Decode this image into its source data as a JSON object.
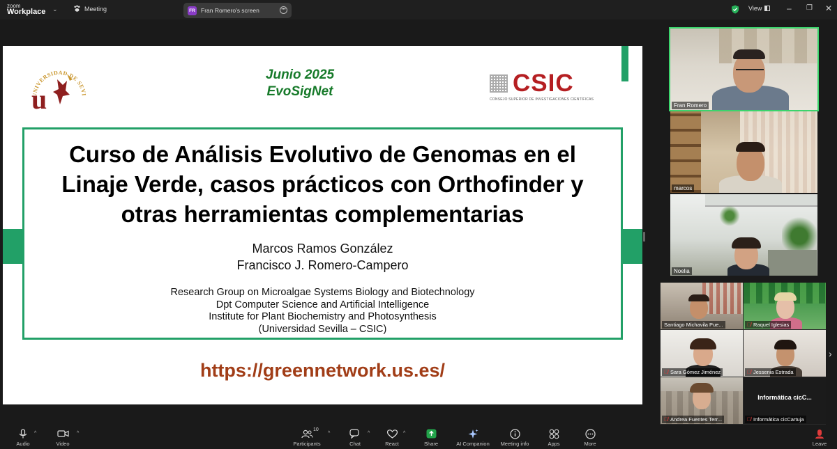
{
  "app": {
    "brand_line1": "zoom",
    "brand_line2": "Workplace"
  },
  "tabs": {
    "meeting": "Meeting",
    "share_badge": "FR",
    "share": "Fran Romero's screen"
  },
  "window": {
    "view": "View"
  },
  "slide": {
    "date_line1": "Junio 2025",
    "date_line2": "EvoSigNet",
    "university_ring": "UNIVERSIDAD DE SEVILLA",
    "csic_word": "CSIC",
    "csic_sub": "CONSEJO SUPERIOR DE INVESTIGACIONES CIENTÍFICAS",
    "title_line1": "Curso de Análisis Evolutivo de Genomas en el",
    "title_line2": "Linaje Verde, casos prácticos con Orthofinder y",
    "title_line3": "otras herramientas complementarias",
    "author1": "Marcos Ramos González",
    "author2": "Francisco J. Romero-Campero",
    "affil1": "Research Group on Microalgae Systems Biology and Biotechnology",
    "affil2": "Dpt Computer Science and Artificial Intelligence",
    "affil3": "Institute for Plant Biochemistry and Photosynthesis",
    "affil4": "(Universidad Sevilla – CSIC)",
    "url": "https://greennetwork.us.es/"
  },
  "speakers": [
    {
      "name": "Fran Romero"
    },
    {
      "name": "marcos"
    },
    {
      "name": "Noelia"
    }
  ],
  "gallery": [
    {
      "name": "Santiago Michavila Pue..."
    },
    {
      "name": "Raquel Iglesias"
    },
    {
      "name": "Sara Gómez Jiménez"
    },
    {
      "name": "Jessenia Estrada"
    },
    {
      "name": "Andrea Fuentes Terr..."
    },
    {
      "name": "Informática cicCartuja",
      "tile_text": "Informática  cicC..."
    }
  ],
  "toolbar": {
    "audio": "Audio",
    "video": "Video",
    "participants": "Participants",
    "participants_count": "10",
    "chat": "Chat",
    "react": "React",
    "share": "Share",
    "ai": "AI Companion",
    "meeting_info": "Meeting info",
    "apps": "Apps",
    "more": "More",
    "leave": "Leave"
  },
  "colors": {
    "slide_green": "#22a067",
    "title_green": "#177a2a",
    "csic_red": "#b51f22",
    "url_red": "#a13d17",
    "share_green": "#22a34a",
    "active_border": "#3bd46c"
  }
}
